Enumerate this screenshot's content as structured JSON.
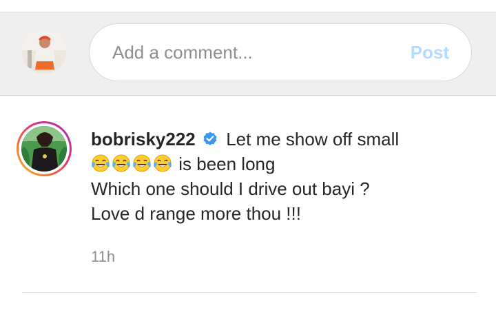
{
  "comment_bar": {
    "placeholder": "Add a comment...",
    "post_label": "Post",
    "post_color": "#b3dbff"
  },
  "post": {
    "username": "bobrisky222",
    "verified_icon": "verified-badge-icon",
    "caption_line1": "Let me show off small",
    "emoji_name": "face-with-tears-of-joy",
    "emoji_count": 4,
    "caption_line2": "is been long",
    "caption_line3": "Which one should I drive out bayi ?",
    "caption_line4": "Love d range more thou !!!",
    "timestamp": "11h"
  },
  "colors": {
    "verified": "#3897f0",
    "text": "#262626",
    "muted": "#8e8e8e"
  }
}
